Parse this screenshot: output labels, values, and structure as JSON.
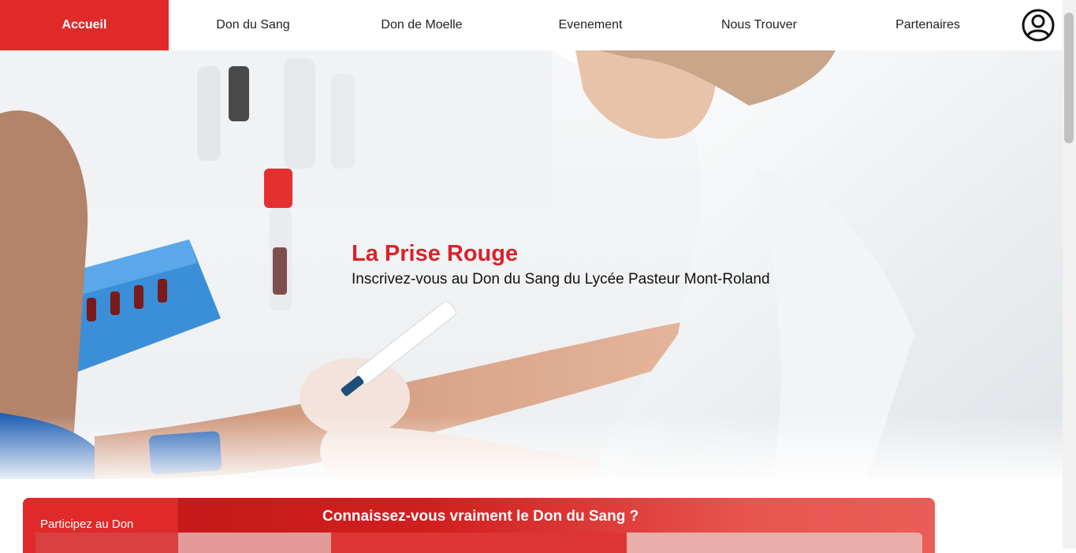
{
  "nav": {
    "items": [
      {
        "label": "Accueil",
        "active": true
      },
      {
        "label": "Don du Sang"
      },
      {
        "label": "Don de Moelle"
      },
      {
        "label": "Evenement"
      },
      {
        "label": "Nous Trouver"
      },
      {
        "label": "Partenaires"
      }
    ],
    "user_icon": "user-circle-icon"
  },
  "hero": {
    "title": "La Prise Rouge",
    "subtitle": "Inscrivez-vous au Don du Sang du Lycée Pasteur Mont-Roland"
  },
  "card": {
    "tab_label": "Participez au Don",
    "title": "Connaissez-vous vraiment le Don du Sang ?"
  },
  "colors": {
    "accent": "#e02a2a",
    "title_red": "#d8232a"
  }
}
